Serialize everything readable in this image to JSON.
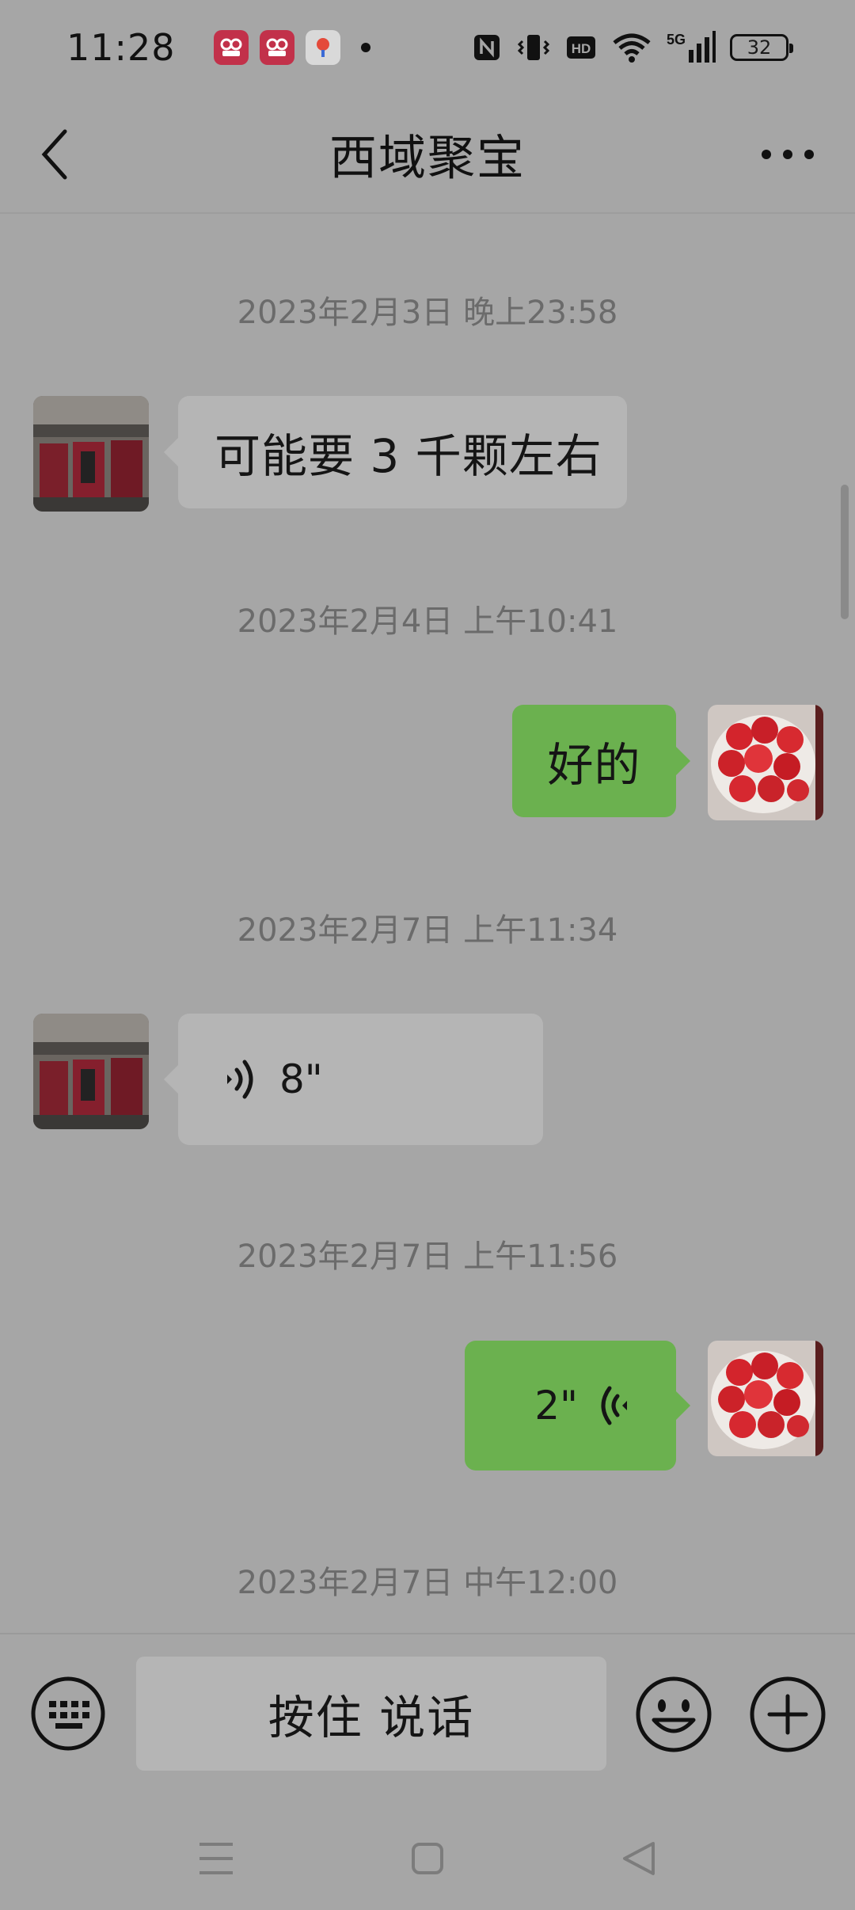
{
  "status_bar": {
    "time": "11:28",
    "notification_icons": [
      "kuaishou-icon",
      "kuaishou-icon",
      "baidu-map-icon"
    ],
    "system_icons": [
      "nfc-icon",
      "vibrate-icon",
      "hd-icon",
      "wifi-icon",
      "5g-signal-icon"
    ],
    "battery": "32"
  },
  "header": {
    "title": "西域聚宝"
  },
  "messages": [
    {
      "timestamp": "2023年2月3日 晚上23:58"
    },
    {
      "text": "可能要 3 千颗左右"
    },
    {
      "timestamp": "2023年2月4日 上午10:41"
    },
    {
      "text": "好的"
    },
    {
      "timestamp": "2023年2月7日 上午11:34"
    },
    {
      "voice_length": "8\""
    },
    {
      "timestamp": "2023年2月7日 上午11:56"
    },
    {
      "voice_length": "2\""
    },
    {
      "timestamp": "2023年2月7日 中午12:00"
    }
  ],
  "input_bar": {
    "hold_to_talk": "按住 说话"
  },
  "colors": {
    "background": "#a6a6a6",
    "incoming_bubble": "#b5b5b5",
    "outgoing_bubble": "#6bb14f"
  }
}
